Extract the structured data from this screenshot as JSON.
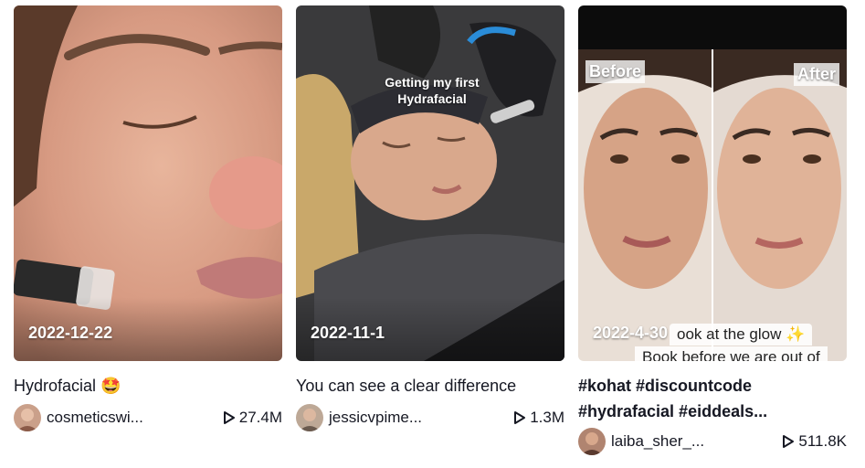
{
  "videos": [
    {
      "date": "2022-12-22",
      "caption": "Hydrofacial",
      "emoji": "🤩",
      "username": "cosmeticswi...",
      "views": "27.4M",
      "icon": "play-icon"
    },
    {
      "date": "2022-11-1",
      "overlay_text": "Getting my first Hydrafacial",
      "caption": "You can see a clear difference",
      "username": "jessicvpime...",
      "views": "1.3M",
      "icon": "play-icon"
    },
    {
      "date": "2022-4-30",
      "before_label": "Before",
      "after_label": "After",
      "banner_line1": "ook at the glow ✨",
      "banner_line2": "Book before we are out of",
      "caption_line1": "#kohat #discountcode",
      "caption_line2": "#hydrafacial #eiddeals...",
      "username": "laiba_sher_...",
      "views": "511.8K",
      "icon": "play-icon"
    }
  ],
  "colors": {
    "text": "#161823",
    "date_text": "#ffffff"
  }
}
